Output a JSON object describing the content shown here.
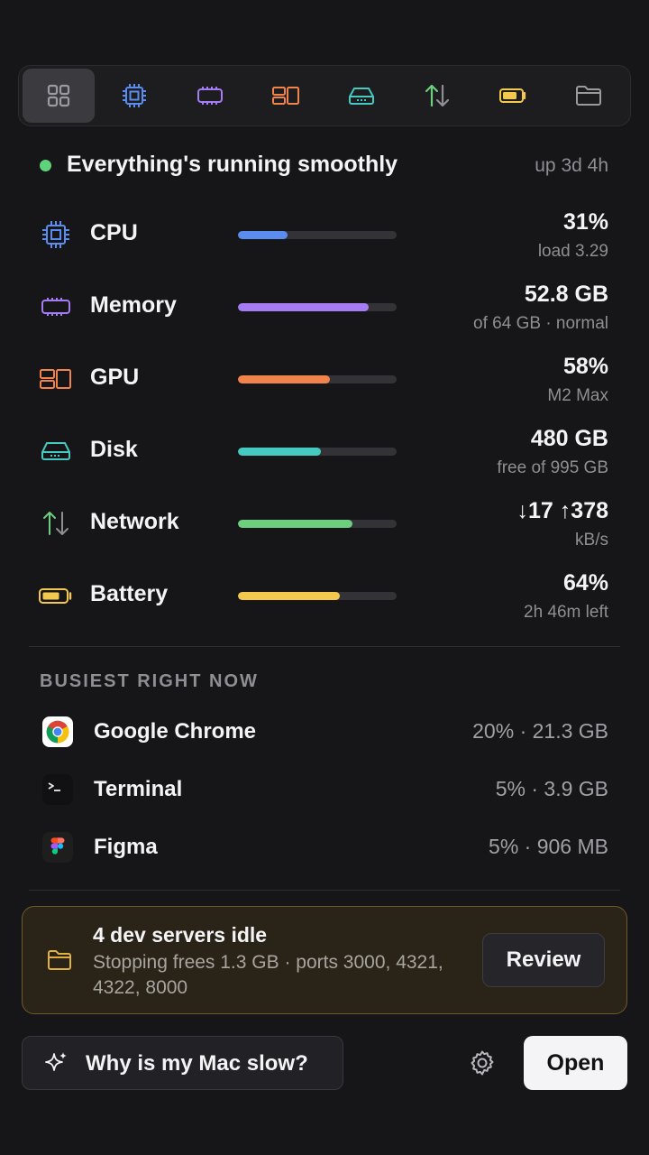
{
  "toolbar": {
    "tabs": [
      {
        "name": "overview",
        "icon": "grid-icon",
        "color": "#9a9aa0",
        "active": true
      },
      {
        "name": "cpu",
        "icon": "cpu-chip-icon",
        "color": "#5b8def"
      },
      {
        "name": "memory",
        "icon": "memory-icon",
        "color": "#a57cf4"
      },
      {
        "name": "gpu",
        "icon": "gpu-icon",
        "color": "#f0844a"
      },
      {
        "name": "disk",
        "icon": "disk-drive-icon",
        "color": "#45c9c0"
      },
      {
        "name": "network",
        "icon": "arrows-up-down-icon",
        "color": "#6dce7e"
      },
      {
        "name": "battery",
        "icon": "battery-icon",
        "color": "#f2c94c"
      },
      {
        "name": "folder",
        "icon": "folder-icon",
        "color": "#9a9aa0"
      }
    ]
  },
  "status": {
    "text": "Everything's running smoothly",
    "uptime": "up 3d 4h",
    "dot_color": "#5ed37a"
  },
  "metrics": [
    {
      "label": "CPU",
      "value": "31%",
      "sub": "load 3.29",
      "fill": 0.31,
      "color": "#5b8def",
      "icon": "cpu-chip-icon"
    },
    {
      "label": "Memory",
      "value": "52.8 GB",
      "sub": "of 64 GB · normal",
      "fill": 0.825,
      "color": "#a57cf4",
      "icon": "memory-icon"
    },
    {
      "label": "GPU",
      "value": "58%",
      "sub": "M2 Max",
      "fill": 0.58,
      "color": "#f0844a",
      "icon": "gpu-icon"
    },
    {
      "label": "Disk",
      "value": "480 GB",
      "sub": "free of 995 GB",
      "fill": 0.52,
      "color": "#45c9c0",
      "icon": "disk-drive-icon"
    },
    {
      "label": "Network",
      "value": "↓17 ↑378",
      "sub": "kB/s",
      "fill": 0.72,
      "color": "#6dce7e",
      "icon": "arrows-up-down-icon"
    },
    {
      "label": "Battery",
      "value": "64%",
      "sub": "2h 46m left",
      "fill": 0.64,
      "color": "#f2c94c",
      "icon": "battery-icon"
    }
  ],
  "busiest": {
    "title": "BUSIEST RIGHT NOW",
    "apps": [
      {
        "name": "Google Chrome",
        "usage": "20% · 21.3 GB",
        "icon": "chrome-icon"
      },
      {
        "name": "Terminal",
        "usage": "5% · 3.9 GB",
        "icon": "terminal-icon"
      },
      {
        "name": "Figma",
        "usage": "5% · 906 MB",
        "icon": "figma-icon"
      }
    ]
  },
  "notice": {
    "title": "4 dev servers idle",
    "body": "Stopping frees 1.3 GB · ports 3000, 4321, 4322, 8000",
    "action": "Review",
    "accent": "#e0b040"
  },
  "footer": {
    "ask_label": "Why is my Mac slow?",
    "open_label": "Open"
  }
}
